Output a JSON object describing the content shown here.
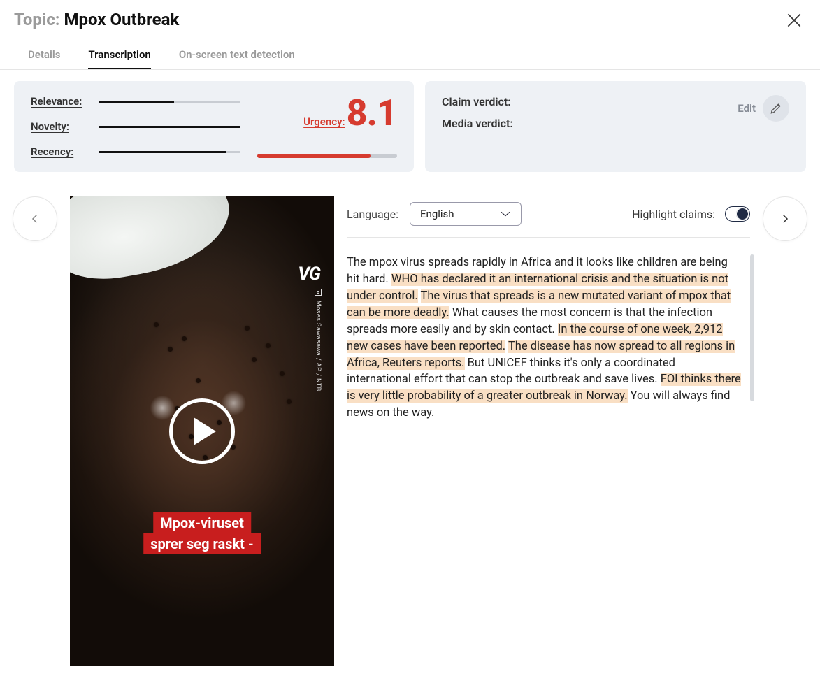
{
  "header": {
    "topic_prefix": "Topic:",
    "topic_name": "Mpox Outbreak"
  },
  "tabs": {
    "details": "Details",
    "transcription": "Transcription",
    "osd": "On-screen text detection",
    "active": "transcription"
  },
  "metrics": {
    "relevance": {
      "label": "Relevance:",
      "pct": 53
    },
    "novelty": {
      "label": "Novelty:",
      "pct": 100
    },
    "recency": {
      "label": "Recency:",
      "pct": 90
    },
    "urgency": {
      "label": "Urgency:",
      "value": "8.1",
      "pct": 81
    }
  },
  "verdicts": {
    "claim": "Claim verdict:",
    "media": "Media verdict:",
    "edit": "Edit"
  },
  "video": {
    "logo": "VG",
    "credit": "Moses Sawasawa / AP / NTB",
    "caption_line1": "Mpox-viruset",
    "caption_line2": "sprer seg raskt -"
  },
  "transcript": {
    "language_label": "Language:",
    "language_value": "English",
    "highlight_label": "Highlight claims:",
    "highlight_on": true,
    "segments": [
      {
        "t": "The mpox virus spreads rapidly in Africa and it looks like children are being hit hard. ",
        "hl": false
      },
      {
        "t": "WHO has declared it an international crisis and the situation is not under control.",
        "hl": true
      },
      {
        "t": " ",
        "hl": false
      },
      {
        "t": "The virus that spreads is a new mutated variant of mpox that can be more deadly.",
        "hl": true
      },
      {
        "t": " What causes the most concern is that the infection spreads more easily and by skin contact. ",
        "hl": false
      },
      {
        "t": "In the course of one week, 2,912 new cases have been reported.",
        "hl": true
      },
      {
        "t": " ",
        "hl": false
      },
      {
        "t": "The disease has now spread to all regions in Africa, Reuters reports.",
        "hl": true
      },
      {
        "t": " But UNICEF thinks it's only a coordinated international effort that can stop the outbreak and save lives. ",
        "hl": false
      },
      {
        "t": "FOI thinks there is very little probability of a greater outbreak in Norway.",
        "hl": true
      },
      {
        "t": " You will always find news on the way.",
        "hl": false
      }
    ]
  }
}
